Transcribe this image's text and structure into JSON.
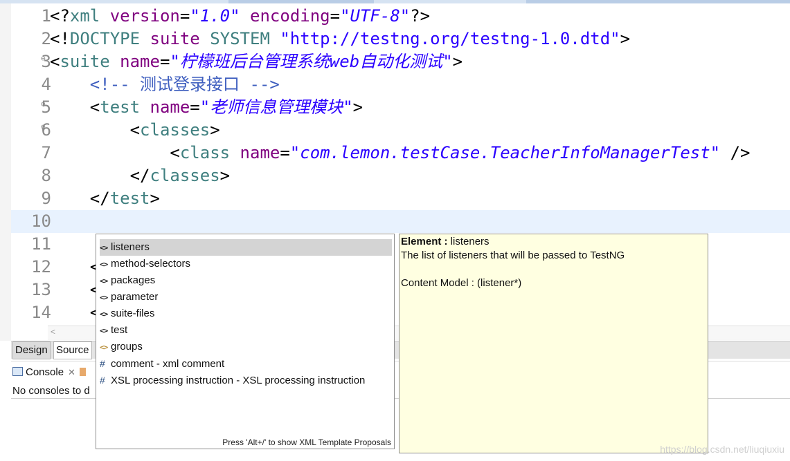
{
  "editor": {
    "lines": [
      {
        "num": "1",
        "parts": [
          [
            "punct",
            "<?"
          ],
          [
            "tag",
            "xml "
          ],
          [
            "attr",
            "version"
          ],
          [
            "punct",
            "="
          ],
          [
            "dq",
            "\""
          ],
          [
            "str",
            "1.0"
          ],
          [
            "dq",
            "\""
          ],
          [
            "tag",
            " "
          ],
          [
            "attr",
            "encoding"
          ],
          [
            "punct",
            "="
          ],
          [
            "dq",
            "\""
          ],
          [
            "str",
            "UTF-8"
          ],
          [
            "dq",
            "\""
          ],
          [
            "punct",
            "?>"
          ]
        ]
      },
      {
        "num": "2",
        "parts": [
          [
            "punct",
            "<!"
          ],
          [
            "tag",
            "DOCTYPE "
          ],
          [
            "attr",
            "suite"
          ],
          [
            "tag",
            " SYSTEM "
          ],
          [
            "dq",
            "\"http://testng.org/testng-1.0.dtd\""
          ],
          [
            "punct",
            ">"
          ]
        ]
      },
      {
        "num": "3",
        "fold": true,
        "parts": [
          [
            "punct",
            "<"
          ],
          [
            "tag",
            "suite "
          ],
          [
            "attr",
            "name"
          ],
          [
            "punct",
            "="
          ],
          [
            "dq",
            "\""
          ],
          [
            "str",
            "柠檬班后台管理系统web自动化测试"
          ],
          [
            "dq",
            "\""
          ],
          [
            "punct",
            ">"
          ]
        ]
      },
      {
        "num": "4",
        "parts": [
          [
            "punct",
            "    "
          ],
          [
            "cmt",
            "<!-- 测试登录接口 -->"
          ]
        ]
      },
      {
        "num": "5",
        "fold": true,
        "parts": [
          [
            "punct",
            "    <"
          ],
          [
            "tag",
            "test "
          ],
          [
            "attr",
            "name"
          ],
          [
            "punct",
            "="
          ],
          [
            "dq",
            "\""
          ],
          [
            "str",
            "老师信息管理模块"
          ],
          [
            "dq",
            "\""
          ],
          [
            "punct",
            ">"
          ]
        ]
      },
      {
        "num": "6",
        "fold": true,
        "parts": [
          [
            "punct",
            "        <"
          ],
          [
            "tag",
            "classes"
          ],
          [
            "punct",
            ">"
          ]
        ]
      },
      {
        "num": "7",
        "parts": [
          [
            "punct",
            "            <"
          ],
          [
            "tag",
            "class "
          ],
          [
            "attr",
            "name"
          ],
          [
            "punct",
            "="
          ],
          [
            "dq",
            "\""
          ],
          [
            "str",
            "com.lemon.testCase.TeacherInfoManagerTest"
          ],
          [
            "dq",
            "\""
          ],
          [
            "punct",
            " />"
          ]
        ]
      },
      {
        "num": "8",
        "parts": [
          [
            "punct",
            "        </"
          ],
          [
            "tag",
            "classes"
          ],
          [
            "punct",
            ">"
          ]
        ]
      },
      {
        "num": "9",
        "parts": [
          [
            "punct",
            "    </"
          ],
          [
            "tag",
            "test"
          ],
          [
            "punct",
            ">"
          ]
        ]
      },
      {
        "num": "10",
        "current": true,
        "parts": []
      },
      {
        "num": "11",
        "parts": []
      },
      {
        "num": "12",
        "parts": [
          [
            "punct",
            "    <"
          ]
        ]
      },
      {
        "num": "13",
        "parts": [
          [
            "punct",
            "    <"
          ]
        ]
      },
      {
        "num": "14",
        "parts": [
          [
            "punct",
            "    <"
          ]
        ]
      }
    ]
  },
  "bottom_tabs": {
    "design": "Design",
    "source": "Source"
  },
  "console": {
    "tab_label": "Console",
    "message": "No consoles to d"
  },
  "popup": {
    "items": [
      {
        "icon": "<>",
        "label": "listeners",
        "selected": true
      },
      {
        "icon": "<>",
        "label": "method-selectors"
      },
      {
        "icon": "<>",
        "label": "packages"
      },
      {
        "icon": "<>",
        "label": "parameter"
      },
      {
        "icon": "<>",
        "label": "suite-files"
      },
      {
        "icon": "<>",
        "label": "test"
      },
      {
        "icon": "<>",
        "label": "groups",
        "muted": true
      },
      {
        "icon": "#",
        "label": "comment - xml comment"
      },
      {
        "icon": "#",
        "label": "XSL processing instruction - XSL processing instruction"
      }
    ],
    "footer": "Press 'Alt+/' to show XML Template Proposals"
  },
  "info": {
    "element_label": "Element :",
    "element_value": " listeners",
    "description": "The list of listeners that will be passed to TestNG",
    "content_model": "Content Model : (listener*)"
  },
  "watermark": "https://blog.csdn.net/liuqiuxiu"
}
